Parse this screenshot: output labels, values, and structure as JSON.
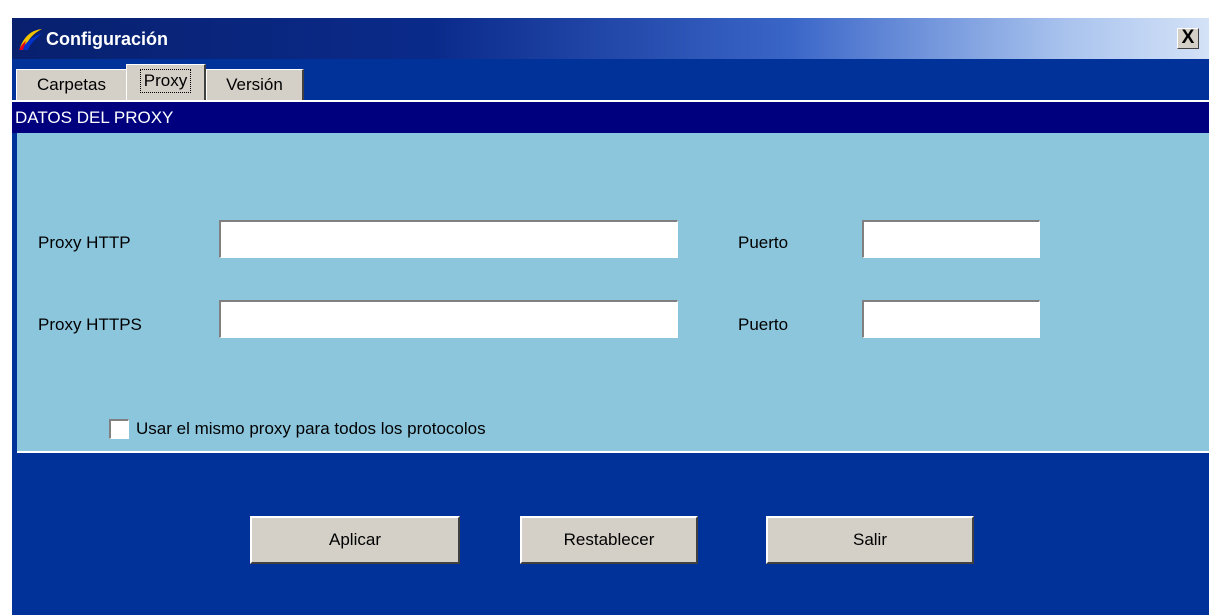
{
  "window": {
    "title": "Configuración",
    "close_label": "X"
  },
  "tabs": [
    {
      "label": "Carpetas",
      "active": false
    },
    {
      "label": "Proxy",
      "active": true
    },
    {
      "label": "Versión",
      "active": false
    }
  ],
  "section": {
    "header": "DATOS DEL PROXY"
  },
  "form": {
    "http_label": "Proxy HTTP",
    "http_value": "",
    "http_port_label": "Puerto",
    "http_port_value": "",
    "https_label": "Proxy HTTPS",
    "https_value": "",
    "https_port_label": "Puerto",
    "https_port_value": "",
    "same_proxy_label": "Usar el mismo proxy para todos los protocolos",
    "same_proxy_checked": false
  },
  "buttons": {
    "apply": "Aplicar",
    "reset": "Restablecer",
    "exit": "Salir"
  },
  "colors": {
    "window_background": "#00329a",
    "section_header": "#00007f",
    "form_panel": "#8cc6dd",
    "button_face": "#d4d0c8"
  },
  "icons": {
    "app": "configuracion-swoosh-icon"
  }
}
